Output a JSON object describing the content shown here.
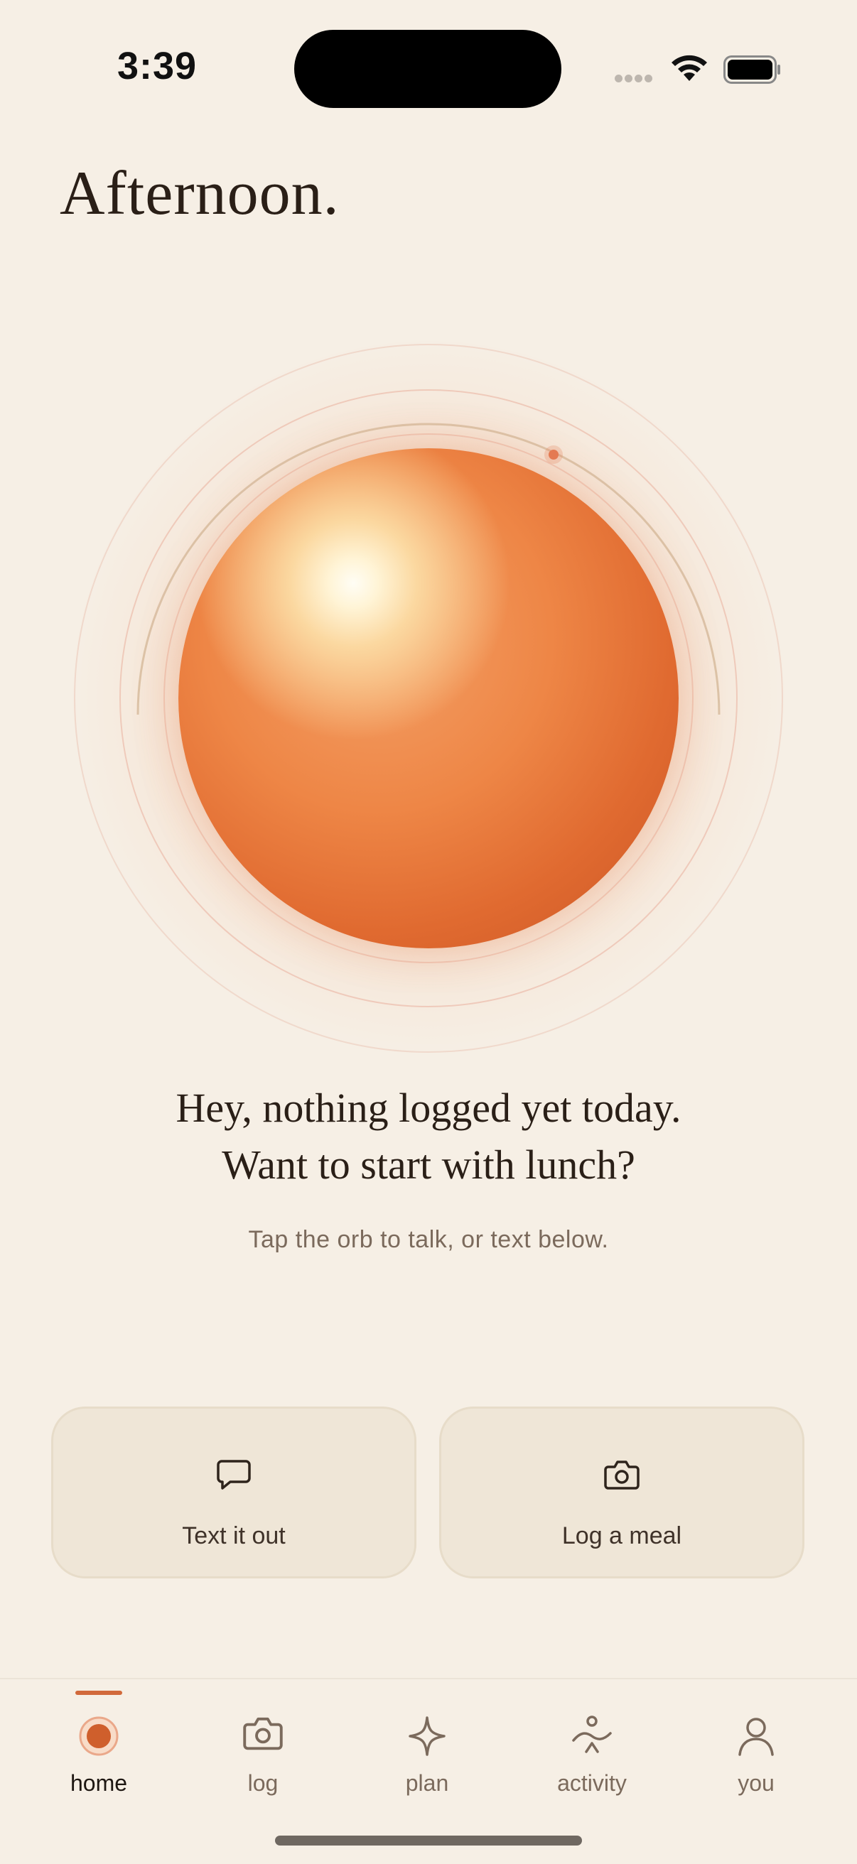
{
  "status_bar": {
    "time": "3:39",
    "icons": [
      "cellular-dots-icon",
      "wifi-icon",
      "battery-icon"
    ]
  },
  "greeting": "Afternoon.",
  "orb": {
    "colors": {
      "core": "#ee8646",
      "highlight": "#fff4d6",
      "dot": "#e47a52"
    }
  },
  "prompt": {
    "line1": "Hey, nothing logged yet today.",
    "line2": "Want to start with lunch?"
  },
  "hint": "Tap the orb to talk, or text below.",
  "actions": [
    {
      "label": "Text it out",
      "icon": "chat-bubble-icon"
    },
    {
      "label": "Log a meal",
      "icon": "camera-icon"
    }
  ],
  "tabs": [
    {
      "label": "home",
      "icon": "orb-icon",
      "active": true
    },
    {
      "label": "log",
      "icon": "camera-icon",
      "active": false
    },
    {
      "label": "plan",
      "icon": "sparkle-icon",
      "active": false
    },
    {
      "label": "activity",
      "icon": "activity-icon",
      "active": false
    },
    {
      "label": "you",
      "icon": "person-icon",
      "active": false
    }
  ],
  "colors": {
    "background": "#f6efe5",
    "accent": "#d1693b",
    "card": "#efe6d7"
  }
}
